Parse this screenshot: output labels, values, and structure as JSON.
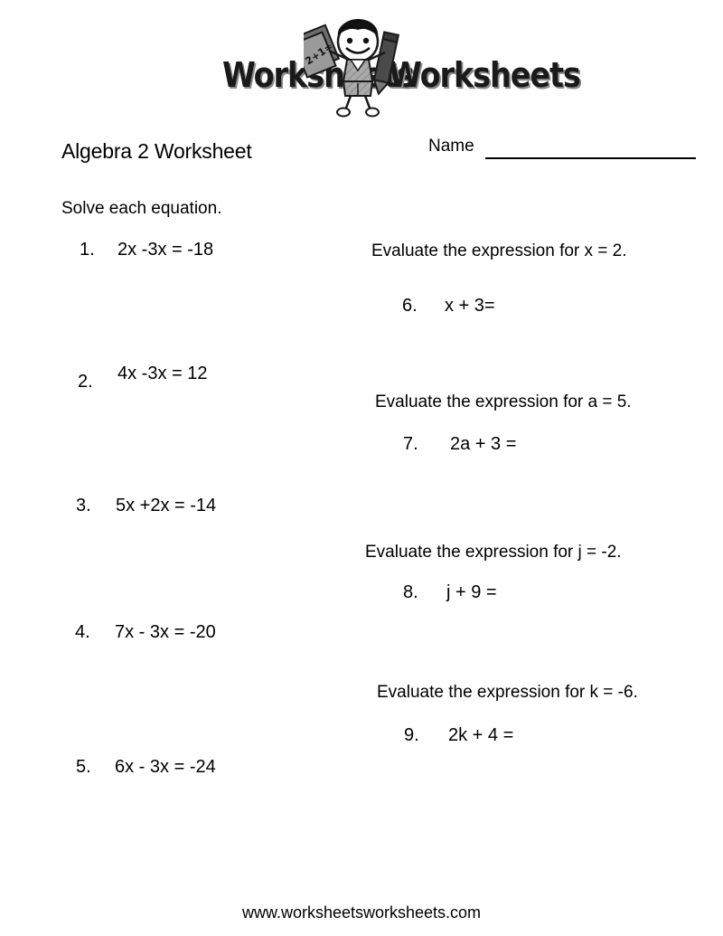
{
  "logo": {
    "word_left": "Worksheets",
    "word_right": "Worksheets",
    "paper_text": "2+1=",
    "kid_icon": "kid-with-paper-and-pencil-icon"
  },
  "header": {
    "title": "Algebra 2 Worksheet",
    "name_label": "Name",
    "name_value": "",
    "instruction": "Solve each equation."
  },
  "left_column": {
    "problems": [
      {
        "number": "1.",
        "expression": "2x -3x = -18"
      },
      {
        "number": "2.",
        "expression": "4x -3x = 12"
      },
      {
        "number": "3.",
        "expression": "5x +2x = -14"
      },
      {
        "number": "4.",
        "expression": "7x - 3x = -20"
      },
      {
        "number": "5.",
        "expression": "6x - 3x = -24"
      }
    ]
  },
  "right_column": {
    "groups": [
      {
        "prompt": "Evaluate the expression for x = 2.",
        "number": "6.",
        "expression": "x + 3="
      },
      {
        "prompt": "Evaluate the expression for a = 5.",
        "number": "7.",
        "expression": "2a + 3 ="
      },
      {
        "prompt": "Evaluate the expression for j = -2.",
        "number": "8.",
        "expression": "j + 9 ="
      },
      {
        "prompt": "Evaluate the expression for k = -6.",
        "number": "9.",
        "expression": "2k + 4 ="
      }
    ]
  },
  "footer": {
    "url": "www.worksheetsworksheets.com"
  },
  "colors": {
    "text": "#000000",
    "background": "#ffffff",
    "logo_shadow": "#8a8a8a",
    "logo_dark": "#1a1a1a",
    "figure_gray": "#8c8c8c"
  }
}
